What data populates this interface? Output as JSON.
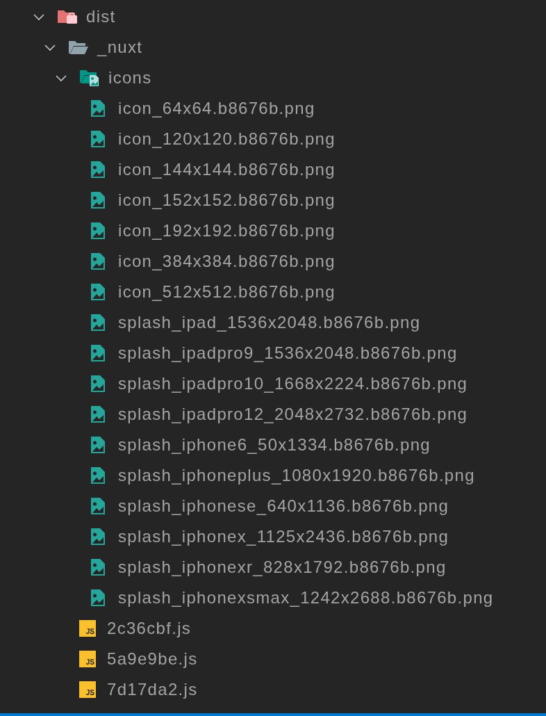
{
  "tree": [
    {
      "name": "dist",
      "kind": "distfolder",
      "expanded": true,
      "children": [
        {
          "name": "_nuxt",
          "kind": "folder",
          "expanded": true,
          "children": [
            {
              "name": "icons",
              "kind": "imagefolder",
              "expanded": true,
              "children": [
                {
                  "name": "icon_64x64.b8676b.png",
                  "kind": "image"
                },
                {
                  "name": "icon_120x120.b8676b.png",
                  "kind": "image"
                },
                {
                  "name": "icon_144x144.b8676b.png",
                  "kind": "image"
                },
                {
                  "name": "icon_152x152.b8676b.png",
                  "kind": "image"
                },
                {
                  "name": "icon_192x192.b8676b.png",
                  "kind": "image"
                },
                {
                  "name": "icon_384x384.b8676b.png",
                  "kind": "image"
                },
                {
                  "name": "icon_512x512.b8676b.png",
                  "kind": "image"
                },
                {
                  "name": "splash_ipad_1536x2048.b8676b.png",
                  "kind": "image"
                },
                {
                  "name": "splash_ipadpro9_1536x2048.b8676b.png",
                  "kind": "image"
                },
                {
                  "name": "splash_ipadpro10_1668x2224.b8676b.png",
                  "kind": "image"
                },
                {
                  "name": "splash_ipadpro12_2048x2732.b8676b.png",
                  "kind": "image"
                },
                {
                  "name": "splash_iphone6_50x1334.b8676b.png",
                  "kind": "image"
                },
                {
                  "name": "splash_iphoneplus_1080x1920.b8676b.png",
                  "kind": "image"
                },
                {
                  "name": "splash_iphonese_640x1136.b8676b.png",
                  "kind": "image"
                },
                {
                  "name": "splash_iphonex_1125x2436.b8676b.png",
                  "kind": "image"
                },
                {
                  "name": "splash_iphonexr_828x1792.b8676b.png",
                  "kind": "image"
                },
                {
                  "name": "splash_iphonexsmax_1242x2688.b8676b.png",
                  "kind": "image"
                }
              ]
            },
            {
              "name": "2c36cbf.js",
              "kind": "js",
              "badge": "JS"
            },
            {
              "name": "5a9e9be.js",
              "kind": "js",
              "badge": "JS"
            },
            {
              "name": "7d17da2.js",
              "kind": "js",
              "badge": "JS"
            }
          ]
        }
      ]
    }
  ]
}
